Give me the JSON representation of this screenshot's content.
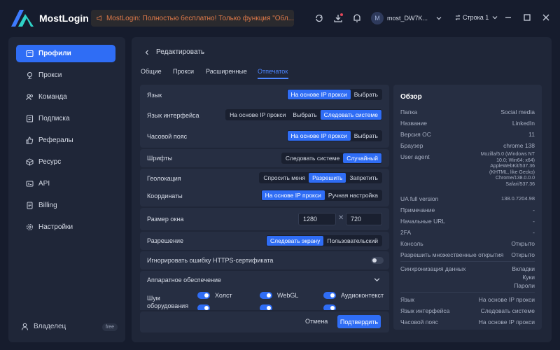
{
  "app": {
    "title": "MostLogin"
  },
  "notice": {
    "text": "MostLogin: Полностью бесплатно! Только функция \"Обл..."
  },
  "user": {
    "avatar_letter": "M",
    "name": "most_DW7K..."
  },
  "row_selector": {
    "label": "Строка 1"
  },
  "sidebar": {
    "items": [
      {
        "label": "Профили",
        "icon": "profile-icon",
        "active": true
      },
      {
        "label": "Прокси",
        "icon": "proxy-icon"
      },
      {
        "label": "Команда",
        "icon": "team-icon"
      },
      {
        "label": "Подписка",
        "icon": "subscription-icon"
      },
      {
        "label": "Рефералы",
        "icon": "referral-icon"
      },
      {
        "label": "Ресурс",
        "icon": "resource-icon"
      },
      {
        "label": "API",
        "icon": "api-icon"
      },
      {
        "label": "Billing",
        "icon": "billing-icon"
      },
      {
        "label": "Настройки",
        "icon": "settings-icon"
      }
    ],
    "owner_label": "Владелец",
    "owner_badge": "free"
  },
  "main": {
    "back_label": "Редактировать",
    "tabs": [
      "Общие",
      "Прокси",
      "Расширенные",
      "Отпечаток"
    ],
    "active_tab": "Отпечаток"
  },
  "form": {
    "language": {
      "label": "Язык",
      "options": [
        "На основе IP прокси",
        "Выбрать"
      ],
      "selected": "На основе IP прокси"
    },
    "ui_language": {
      "label": "Язык интерфейса",
      "options": [
        "На основе IP прокси",
        "Выбрать",
        "Следовать системе"
      ],
      "selected": "Следовать системе"
    },
    "timezone": {
      "label": "Часовой пояс",
      "options": [
        "На основе IP прокси",
        "Выбрать"
      ],
      "selected": "На основе IP прокси"
    },
    "fonts": {
      "label": "Шрифты",
      "options": [
        "Следовать системе",
        "Случайный"
      ],
      "selected": "Случайный"
    },
    "geolocation": {
      "label": "Геолокация",
      "options": [
        "Спросить меня",
        "Разрешить",
        "Запретить"
      ],
      "selected": "Разрешить"
    },
    "coordinates": {
      "label": "Координаты",
      "options": [
        "На основе IP прокси",
        "Ручная настройка"
      ],
      "selected": "На основе IP прокси"
    },
    "window_size": {
      "label": "Размер окна",
      "width": "1280",
      "times": "✕",
      "height": "720"
    },
    "resolution": {
      "label": "Разрешение",
      "options": [
        "Следовать экрану",
        "Пользовательский"
      ],
      "selected": "Следовать экрану"
    },
    "ignore_https": {
      "label": "Игнорировать ошибку HTTPS-сертификата",
      "enabled": false
    },
    "hardware": {
      "label": "Аппаратное обеспечение",
      "noise_label_1": "Шум",
      "noise_label_2": "оборудования",
      "noise_items": [
        {
          "label": "Холст",
          "enabled": true
        },
        {
          "label": "WebGL",
          "enabled": true
        },
        {
          "label": "Аудиоконтекст",
          "enabled": true
        }
      ]
    },
    "cancel_label": "Отмена",
    "confirm_label": "Подтвердить"
  },
  "overview": {
    "title": "Обзор",
    "rows_top": [
      {
        "key": "Папка",
        "value": "Social media"
      },
      {
        "key": "Название",
        "value": "LinkedIn"
      },
      {
        "key": "Версия ОС",
        "value": "11"
      },
      {
        "key": "Браузер",
        "value": "chrome  138"
      }
    ],
    "user_agent_key": "User agent",
    "user_agent_value": "Mozilla/5.0 (Windows NT 10.0; Win64; x64) AppleWebKit/537.36 (KHTML, like Gecko) Chrome/138.0.0.0 Safari/537.36",
    "rows_mid": [
      {
        "key": "UA full version",
        "value": "138.0.7204.98"
      },
      {
        "key": "Примечание",
        "value": "-"
      },
      {
        "key": "Начальные URL",
        "value": "-"
      },
      {
        "key": "2FA",
        "value": "-"
      },
      {
        "key": "Консоль",
        "value": "Открыто"
      },
      {
        "key": "Разрешить множественные открытия",
        "value": "Открыто"
      }
    ],
    "sync_key": "Синхронизация данных",
    "sync_values": [
      "Вкладки",
      "Куки",
      "Пароли"
    ],
    "rows_bottom": [
      {
        "key": "Язык",
        "value": "На основе IP прокси"
      },
      {
        "key": "Язык интерфейса",
        "value": "Следовать системе"
      },
      {
        "key": "Часовой пояс",
        "value": "На основе IP прокси"
      }
    ]
  },
  "colors": {
    "accent": "#2f6df5",
    "bg": "#161c2d",
    "panel": "#1f2638",
    "card": "#262e42",
    "notice_text": "#e07a4a"
  }
}
